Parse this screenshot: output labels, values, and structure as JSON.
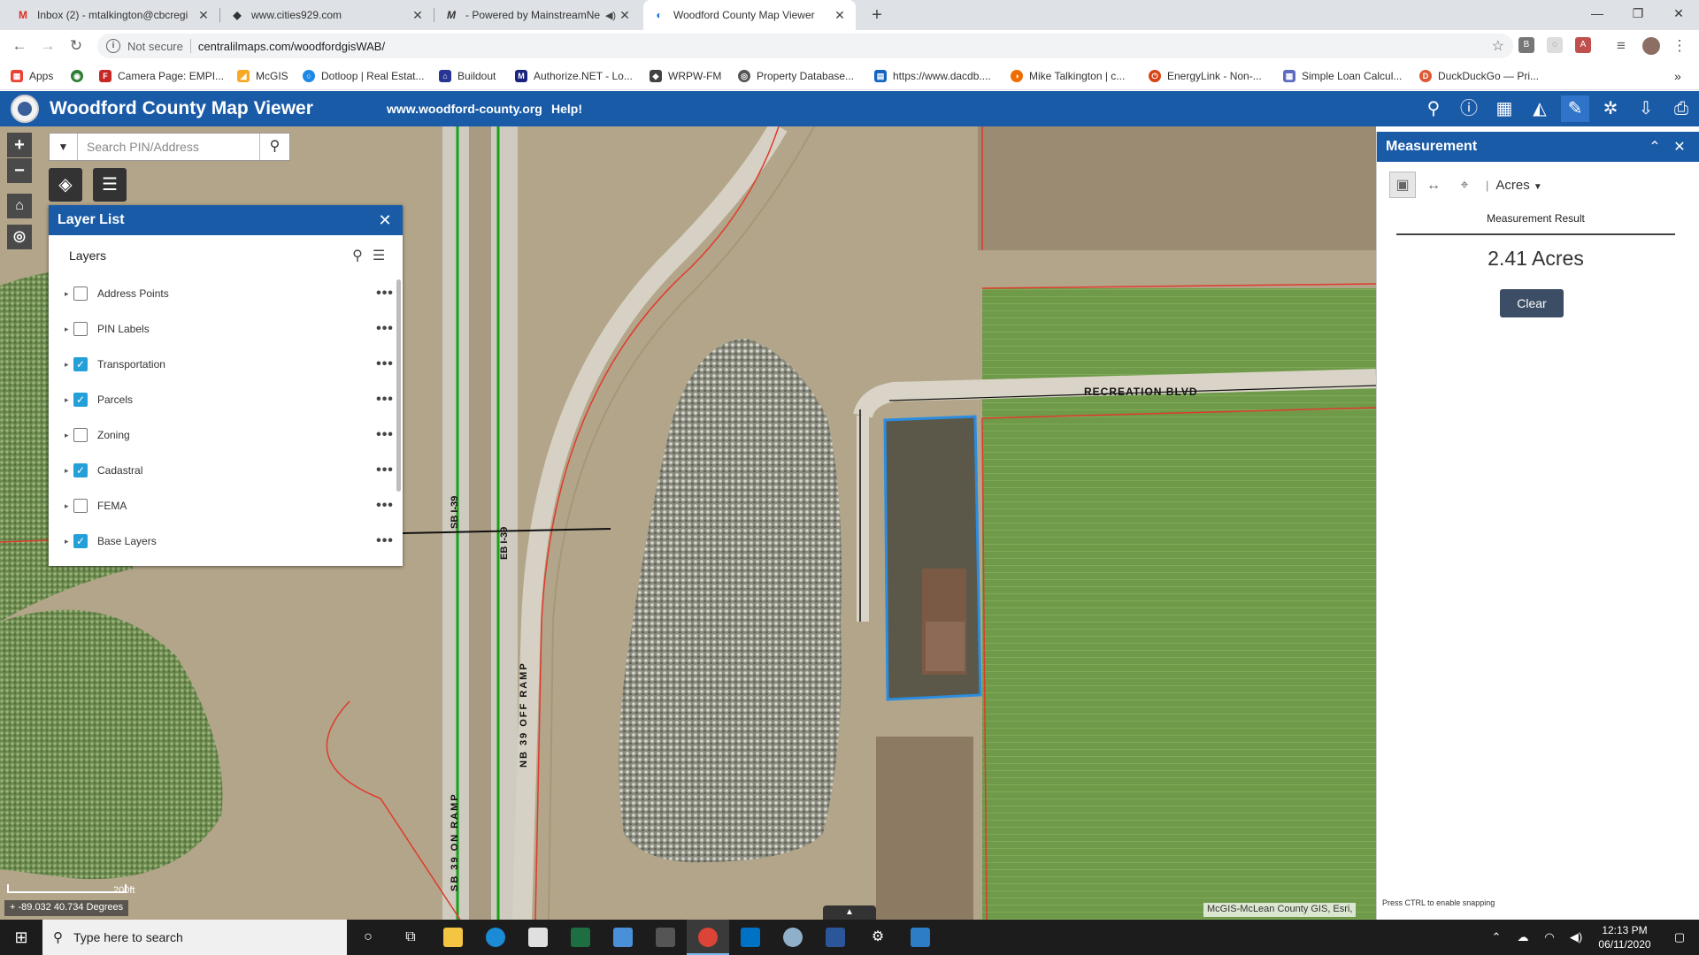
{
  "browser": {
    "tabs": [
      {
        "title": "Inbox (2) - mtalkington@cbcregi",
        "icon": "gmail-icon",
        "active": false
      },
      {
        "title": "www.cities929.com",
        "icon": "cities929-icon",
        "active": false
      },
      {
        "title": "- Powered by MainstreamNe",
        "icon": "mainstream-icon",
        "active": false
      },
      {
        "title": "Woodford County Map Viewer",
        "icon": "arcgis-icon",
        "active": true
      }
    ],
    "security_label": "Not secure",
    "url": "centralilmaps.com/woodfordgisWAB/",
    "bookmarks": [
      {
        "label": "Apps",
        "color": "#ea4335"
      },
      {
        "label": "",
        "color": "#2e7d32"
      },
      {
        "label": "Camera Page: EMPI...",
        "color": "#c62828"
      },
      {
        "label": "McGIS",
        "color": "#f9a825"
      },
      {
        "label": "Dotloop | Real Estat...",
        "color": "#1e88e5"
      },
      {
        "label": "Buildout",
        "color": "#283593"
      },
      {
        "label": "Authorize.NET - Lo...",
        "color": "#1a237e"
      },
      {
        "label": "WRPW-FM",
        "color": "#424242"
      },
      {
        "label": "Property Database...",
        "color": "#555555"
      },
      {
        "label": "https://www.dacdb....",
        "color": "#1565c0"
      },
      {
        "label": "Mike Talkington | c...",
        "color": "#ef6c00"
      },
      {
        "label": "EnergyLink - Non-...",
        "color": "#d84315"
      },
      {
        "label": "Simple Loan Calcul...",
        "color": "#5c6bc0"
      },
      {
        "label": "DuckDuckGo — Pri...",
        "color": "#de5833"
      }
    ]
  },
  "app": {
    "title": "Woodford County Map Viewer",
    "links": [
      "www.woodford-county.org",
      "Help!"
    ],
    "header_tools": [
      "search-icon",
      "info-icon",
      "basemap-gallery-icon",
      "education-icon",
      "measurement-icon",
      "layers-alt-icon",
      "download-icon",
      "print-icon"
    ]
  },
  "search": {
    "placeholder": "Search PIN/Address"
  },
  "layer_list": {
    "title": "Layer List",
    "subtitle": "Layers",
    "layers": [
      {
        "name": "Address Points",
        "checked": false
      },
      {
        "name": "PIN Labels",
        "checked": false
      },
      {
        "name": "Transportation",
        "checked": true
      },
      {
        "name": "Parcels",
        "checked": true
      },
      {
        "name": "Zoning",
        "checked": false
      },
      {
        "name": "Cadastral",
        "checked": true
      },
      {
        "name": "FEMA",
        "checked": false
      },
      {
        "name": "Base Layers",
        "checked": true
      }
    ]
  },
  "measurement": {
    "title": "Measurement",
    "unit": "Acres",
    "result_label": "Measurement Result",
    "result_value": "2.41 Acres",
    "clear_label": "Clear",
    "snap_hint": "Press CTRL to enable snapping"
  },
  "map": {
    "road_labels": [
      "RECREATION BLVD",
      "SB I-39",
      "EB I-39",
      "NB 39 OFF RAMP",
      "SB 39 ON RAMP"
    ],
    "scale_label": "200ft",
    "coordinates": "-89.032 40.734 Degrees",
    "attribution": "McGIS-McLean County GIS, Esri,"
  },
  "taskbar": {
    "search_placeholder": "Type here to search",
    "time": "12:13 PM",
    "date": "06/11/2020"
  }
}
